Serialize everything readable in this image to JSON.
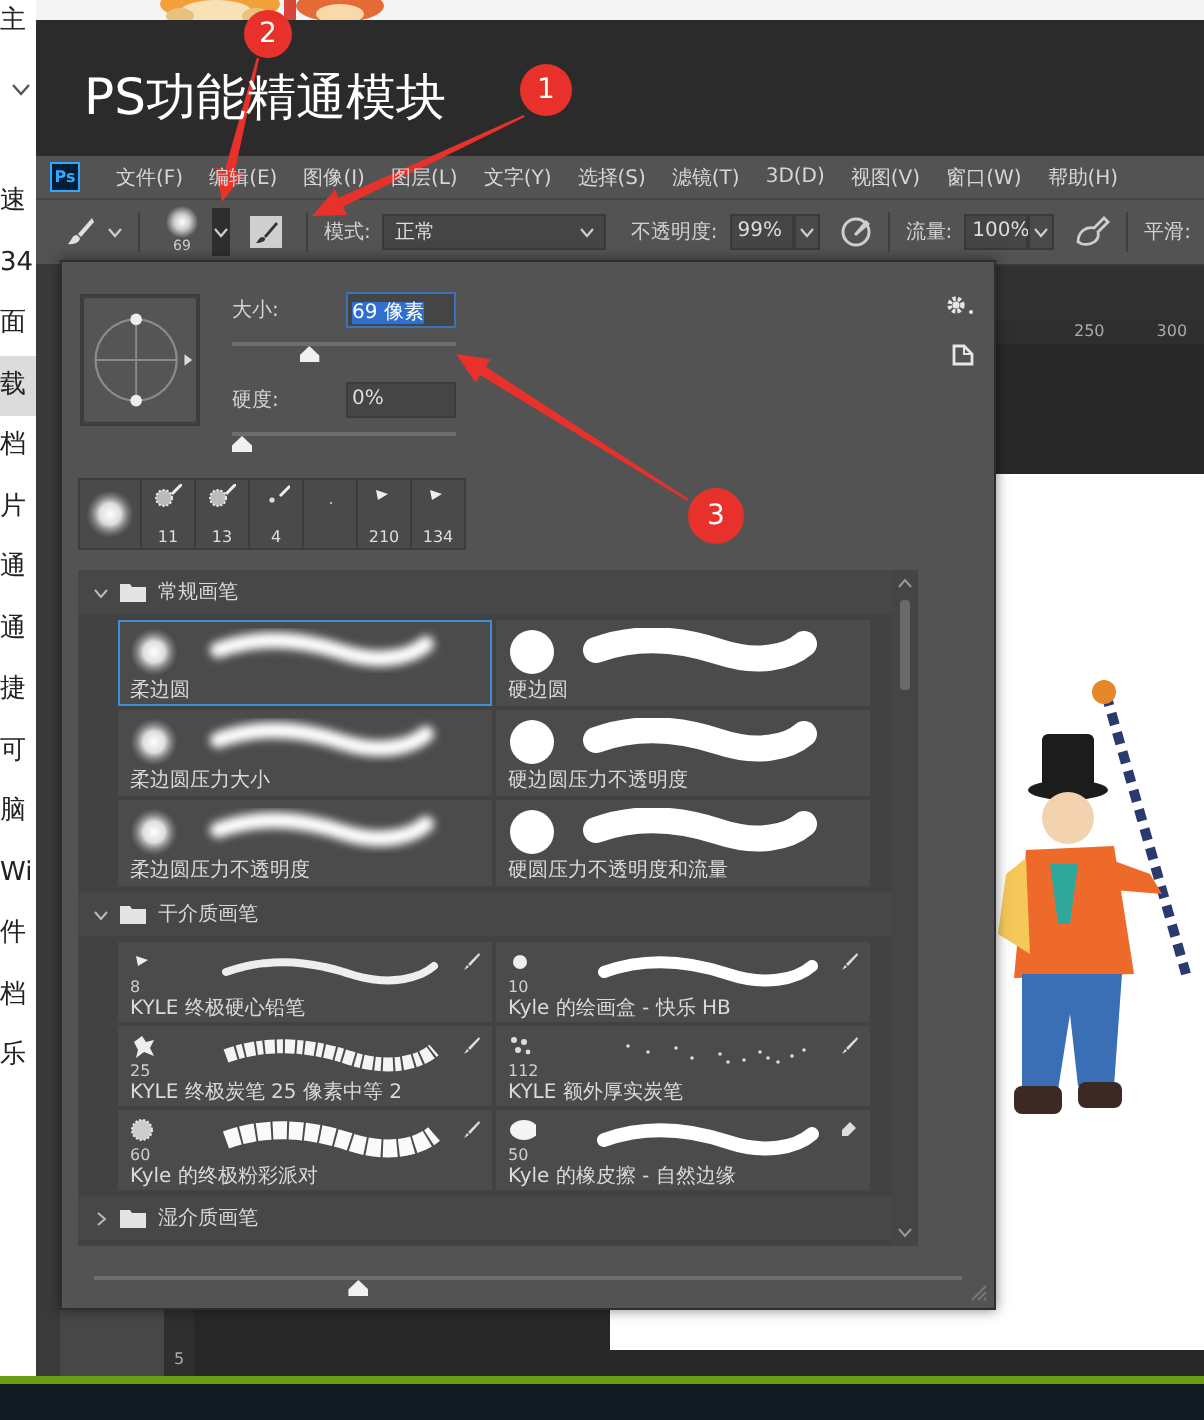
{
  "sidebar": {
    "items": [
      {
        "label": "主",
        "selected": false
      },
      {
        "label": "速",
        "selected": false
      },
      {
        "label": "34",
        "selected": false
      },
      {
        "label": "面",
        "selected": false
      },
      {
        "label": "载",
        "selected": true
      },
      {
        "label": "档",
        "selected": false
      },
      {
        "label": "片",
        "selected": false
      },
      {
        "label": "通",
        "selected": false
      },
      {
        "label": "通",
        "selected": false
      },
      {
        "label": "捷",
        "selected": false
      },
      {
        "label": "可",
        "selected": false
      },
      {
        "label": "脑",
        "selected": false
      },
      {
        "label": "Wi",
        "selected": false
      },
      {
        "label": "件",
        "selected": false
      },
      {
        "label": "档",
        "selected": false
      },
      {
        "label": "乐",
        "selected": false
      }
    ]
  },
  "title": "PS功能精通模块",
  "app_logo": "Ps",
  "menu": [
    "文件(F)",
    "编辑(E)",
    "图像(I)",
    "图层(L)",
    "文字(Y)",
    "选择(S)",
    "滤镜(T)",
    "3D(D)",
    "视图(V)",
    "窗口(W)",
    "帮助(H)"
  ],
  "options_bar": {
    "brush_size": "69",
    "mode_label": "模式:",
    "mode": "正常",
    "opacity_label": "不透明度:",
    "opacity": "99%",
    "flow_label": "流量:",
    "flow": "100%",
    "smoothing_label": "平滑:"
  },
  "rulers": {
    "horizontal": [
      "250",
      "300"
    ],
    "vertical": [
      "5"
    ]
  },
  "brush_panel": {
    "size": {
      "label": "大小:",
      "value": "69 像素",
      "level": 0.33
    },
    "hardness": {
      "label": "硬度:",
      "value": "0%",
      "level": 0
    },
    "recent": [
      {
        "kind": "soft"
      },
      {
        "kind": "spatter",
        "size": "11"
      },
      {
        "kind": "spatter",
        "size": "13"
      },
      {
        "kind": "dot",
        "size": "4"
      },
      {
        "kind": "speck"
      },
      {
        "kind": "pencil",
        "size": "210"
      },
      {
        "kind": "pencil",
        "size": "134"
      }
    ],
    "groups": [
      {
        "name": "常规画笔",
        "expanded": true,
        "brushes": [
          {
            "name": "柔边圆",
            "kind": "soft",
            "selected": true
          },
          {
            "name": "硬边圆",
            "kind": "hard",
            "selected": false
          },
          {
            "name": "柔边圆压力大小",
            "kind": "soft",
            "selected": false
          },
          {
            "name": "硬边圆压力不透明度",
            "kind": "hard",
            "selected": false
          },
          {
            "name": "柔边圆压力不透明度",
            "kind": "soft",
            "selected": false
          },
          {
            "name": "硬圆压力不透明度和流量",
            "kind": "hard",
            "selected": false
          }
        ]
      },
      {
        "name": "干介质画笔",
        "expanded": true,
        "brushes": [
          {
            "name": "KYLE 终极硬心铅笔",
            "size": "8",
            "kind": "pencil",
            "selected": false
          },
          {
            "name": "Kyle 的绘画盒 - 快乐 HB",
            "size": "10",
            "kind": "marker",
            "selected": false
          },
          {
            "name": "KYLE 终极炭笔 25 像素中等 2",
            "size": "25",
            "kind": "charcoal",
            "selected": false
          },
          {
            "name": "KYLE 额外厚实炭笔",
            "size": "112",
            "kind": "speckle",
            "selected": false
          },
          {
            "name": "Kyle 的终极粉彩派对",
            "size": "60",
            "kind": "pastel",
            "selected": false
          },
          {
            "name": "Kyle 的橡皮擦 - 自然边缘",
            "size": "50",
            "kind": "eraser",
            "selected": false
          }
        ]
      },
      {
        "name": "湿介质画笔",
        "expanded": false
      }
    ],
    "preview_slider": {
      "level": 0.3
    }
  },
  "annotations": [
    {
      "number": "1"
    },
    {
      "number": "2"
    },
    {
      "number": "3"
    }
  ]
}
